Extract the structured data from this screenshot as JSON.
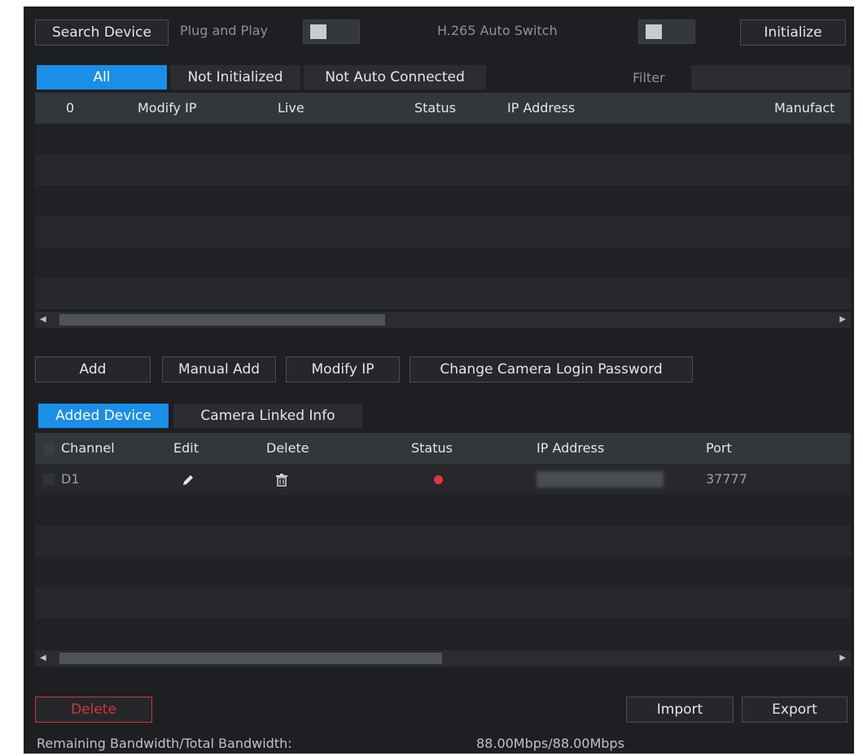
{
  "toolbar": {
    "search_device": "Search Device",
    "plug_and_play": "Plug and Play",
    "h265_auto_switch": "H.265 Auto Switch",
    "initialize": "Initialize"
  },
  "search_tabs": {
    "all": "All",
    "not_initialized": "Not Initialized",
    "not_auto_connected": "Not Auto Connected",
    "filter": "Filter",
    "filter_value": ""
  },
  "search_table": {
    "headers": [
      "0",
      "Modify IP",
      "Live",
      "Status",
      "IP Address",
      "Manufact"
    ]
  },
  "actions": {
    "add": "Add",
    "manual_add": "Manual Add",
    "modify_ip": "Modify IP",
    "change_password": "Change Camera Login Password"
  },
  "added_tabs": {
    "added_device": "Added Device",
    "camera_linked_info": "Camera Linked Info"
  },
  "added_table": {
    "headers": {
      "channel": "Channel",
      "edit": "Edit",
      "delete": "Delete",
      "status": "Status",
      "ip_address": "IP Address",
      "port": "Port"
    },
    "rows": [
      {
        "channel": "D1",
        "status_color": "#e8343f",
        "port": "37777"
      }
    ]
  },
  "footer": {
    "delete": "Delete",
    "import": "Import",
    "export": "Export",
    "bandwidth_label": "Remaining Bandwidth/Total Bandwidth:",
    "bandwidth_value": "88.00Mbps/88.00Mbps"
  },
  "colors": {
    "accent": "#1a8fe8",
    "danger": "#d2343c",
    "offline": "#e8343f"
  },
  "icons": {
    "edit": "pencil-icon",
    "delete": "trash-icon"
  }
}
